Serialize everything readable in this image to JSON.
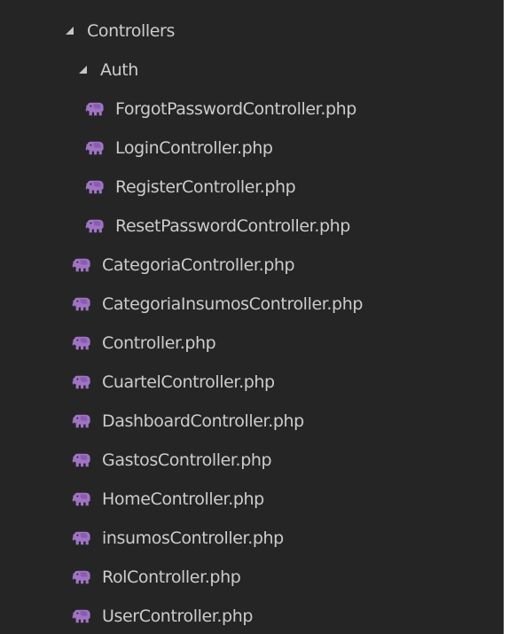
{
  "tree": {
    "root_folder": {
      "label": "Controllers",
      "icon": "chevron-expanded-icon"
    },
    "sub_folder": {
      "label": "Auth",
      "icon": "chevron-expanded-icon"
    },
    "auth_files": [
      {
        "label": "ForgotPasswordController.php",
        "icon": "php-elephant-icon"
      },
      {
        "label": "LoginController.php",
        "icon": "php-elephant-icon"
      },
      {
        "label": "RegisterController.php",
        "icon": "php-elephant-icon"
      },
      {
        "label": "ResetPasswordController.php",
        "icon": "php-elephant-icon"
      }
    ],
    "files": [
      {
        "label": "CategoriaController.php",
        "icon": "php-elephant-icon"
      },
      {
        "label": "CategoriaInsumosController.php",
        "icon": "php-elephant-icon"
      },
      {
        "label": "Controller.php",
        "icon": "php-elephant-icon"
      },
      {
        "label": "CuartelController.php",
        "icon": "php-elephant-icon"
      },
      {
        "label": "DashboardController.php",
        "icon": "php-elephant-icon"
      },
      {
        "label": "GastosController.php",
        "icon": "php-elephant-icon"
      },
      {
        "label": "HomeController.php",
        "icon": "php-elephant-icon"
      },
      {
        "label": "insumosController.php",
        "icon": "php-elephant-icon"
      },
      {
        "label": "RolController.php",
        "icon": "php-elephant-icon"
      },
      {
        "label": "UserController.php",
        "icon": "php-elephant-icon"
      }
    ]
  },
  "colors": {
    "background": "#252526",
    "text": "#cccccc",
    "php_icon": "#a074c4",
    "twisty": "#c5c5c5"
  }
}
